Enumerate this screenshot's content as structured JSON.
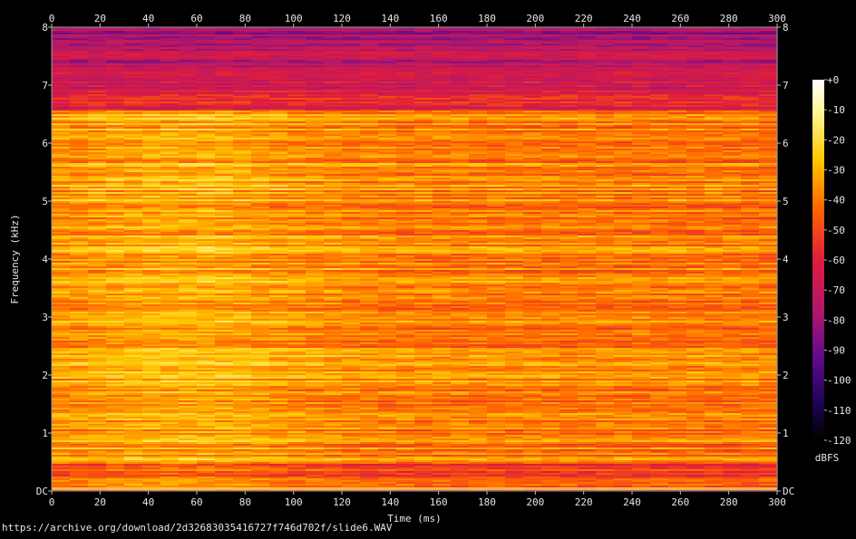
{
  "source_url": "https://archive.org/download/2d32683035416727f746d702f/slide6.WAV",
  "chart_data": {
    "type": "heatmap",
    "xlabel": "Time (ms)",
    "ylabel": "Frequency (kHz)",
    "xlim": [
      0,
      300
    ],
    "ylim": [
      0,
      8
    ],
    "x_ticks": [
      "0",
      "20",
      "40",
      "60",
      "80",
      "100",
      "120",
      "140",
      "160",
      "180",
      "200",
      "220",
      "240",
      "260",
      "280",
      "300"
    ],
    "y_ticks": [
      "DC",
      "1",
      "2",
      "3",
      "4",
      "5",
      "6",
      "7",
      "8"
    ],
    "colorbar": {
      "label": "dBFS",
      "ticks": [
        "+0",
        "-10",
        "-20",
        "-30",
        "-40",
        "-50",
        "-60",
        "-70",
        "-80",
        "-90",
        "-100",
        "-110",
        "-120"
      ],
      "range": [
        -120,
        0
      ]
    }
  }
}
